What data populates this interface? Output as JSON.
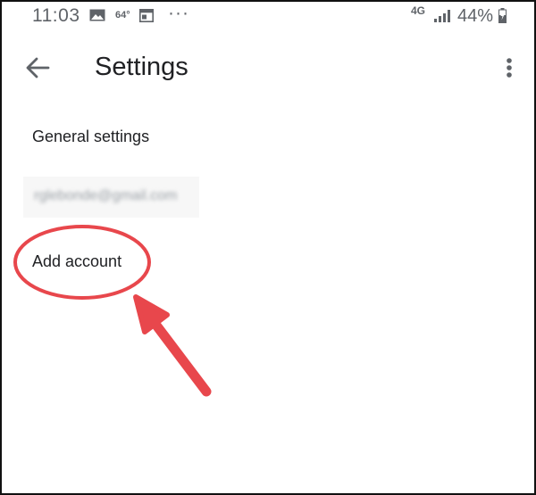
{
  "status_bar": {
    "time": "11:03",
    "temperature": "64°",
    "more": "···",
    "network": "4G",
    "battery": "44%",
    "icons": [
      "photo-icon",
      "calendar-icon",
      "signal-icon",
      "battery-charging-icon"
    ]
  },
  "app_bar": {
    "title": "Settings",
    "back_icon": "arrow-back-icon",
    "more_icon": "more-vert-icon"
  },
  "settings_list": {
    "items": [
      {
        "label": "General settings"
      },
      {
        "label": "rglebonde@gmail.com",
        "obscured": true
      },
      {
        "label": "Add account"
      }
    ]
  },
  "annotation": {
    "color": "#e8474c",
    "type": "circle-and-arrow",
    "target": "Add account"
  },
  "colors": {
    "text_primary": "#202124",
    "icon_gray": "#5f6368",
    "background": "#ffffff"
  }
}
